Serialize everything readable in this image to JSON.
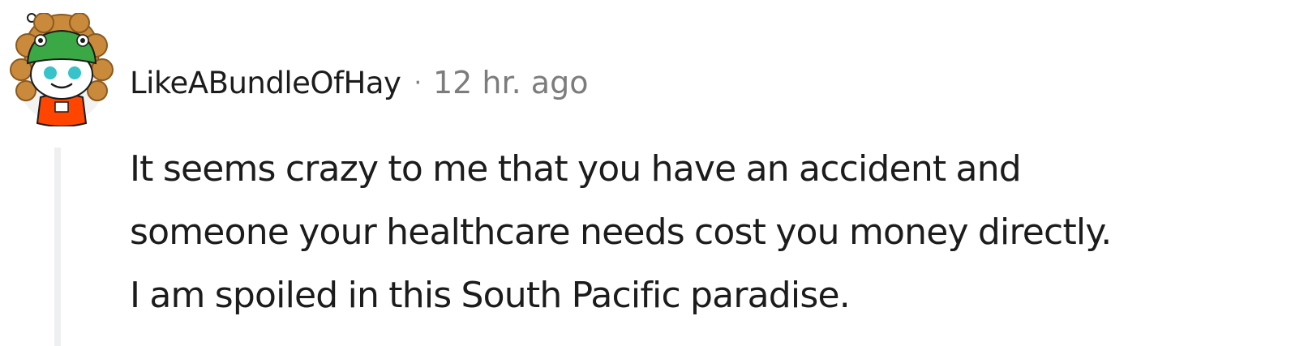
{
  "comment": {
    "author": "LikeABundleOfHay",
    "separator": "·",
    "timestamp": "12 hr. ago",
    "body_lines": [
      "It seems crazy to me that you have an accident and",
      "someone your healthcare needs cost you money directly.",
      "I am spoiled in this South Pacific paradise."
    ]
  },
  "colors": {
    "text_primary": "#1c1c1c",
    "text_meta": "#7c7c7c",
    "thread_line": "#edeff1",
    "avatar_hair": "#c98a3c",
    "avatar_hat": "#3aa845",
    "avatar_eyes": "#36c3c9",
    "avatar_shirt": "#ff4500"
  },
  "icons": {
    "avatar": "snoo-avatar-icon"
  }
}
